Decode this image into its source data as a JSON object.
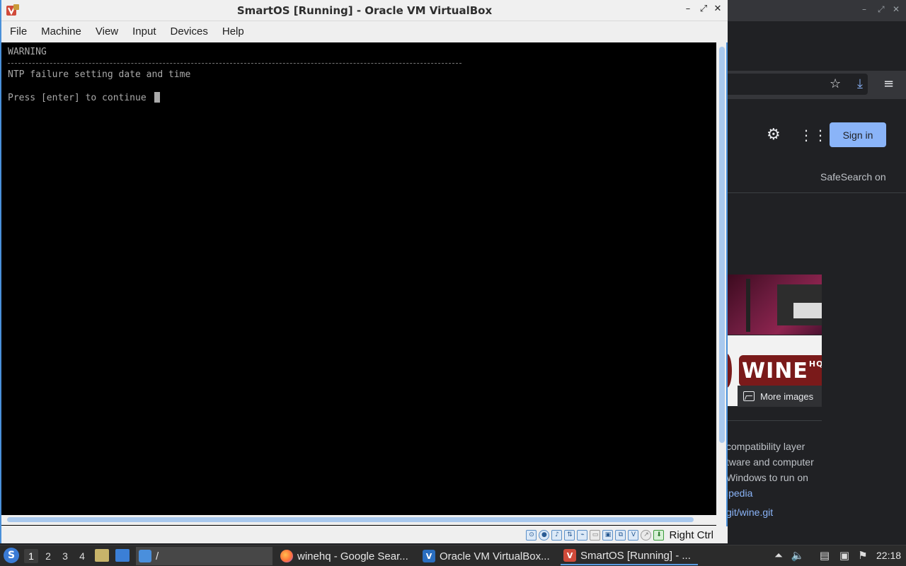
{
  "vbox": {
    "title": "SmartOS [Running] - Oracle VM VirtualBox",
    "menu": [
      "File",
      "Machine",
      "View",
      "Input",
      "Devices",
      "Help"
    ],
    "console": {
      "line1": "WARNING",
      "line2": "NTP failure setting date and time",
      "line3": "Press [enter] to continue "
    },
    "status": {
      "host_key": "Right Ctrl"
    }
  },
  "browser": {
    "signin": "Sign in",
    "safesearch": "SafeSearch on",
    "more_images": "More images",
    "desc": [
      "compatibility layer",
      "tware and computer",
      "Windows to run on"
    ],
    "wiki_link": "ipedia",
    "git_link": "git/wine.git",
    "wine_logo": "WINE",
    "wine_logo_sup": "HQ"
  },
  "taskbar": {
    "workspaces": [
      "1",
      "2",
      "3",
      "4"
    ],
    "folder_task": "/",
    "tasks": [
      {
        "label": "winehq - Google Sear...",
        "icon": "firefox-icon"
      },
      {
        "label": "Oracle VM VirtualBox...",
        "icon": "virtualbox-manager-icon"
      },
      {
        "label": "SmartOS [Running] - ...",
        "icon": "virtualbox-vm-icon"
      }
    ],
    "clock": "22:18"
  },
  "colors": {
    "accent": "#8ab4f8",
    "taskbar": "#2b2b2b",
    "console_text": "#aaaaaa"
  }
}
